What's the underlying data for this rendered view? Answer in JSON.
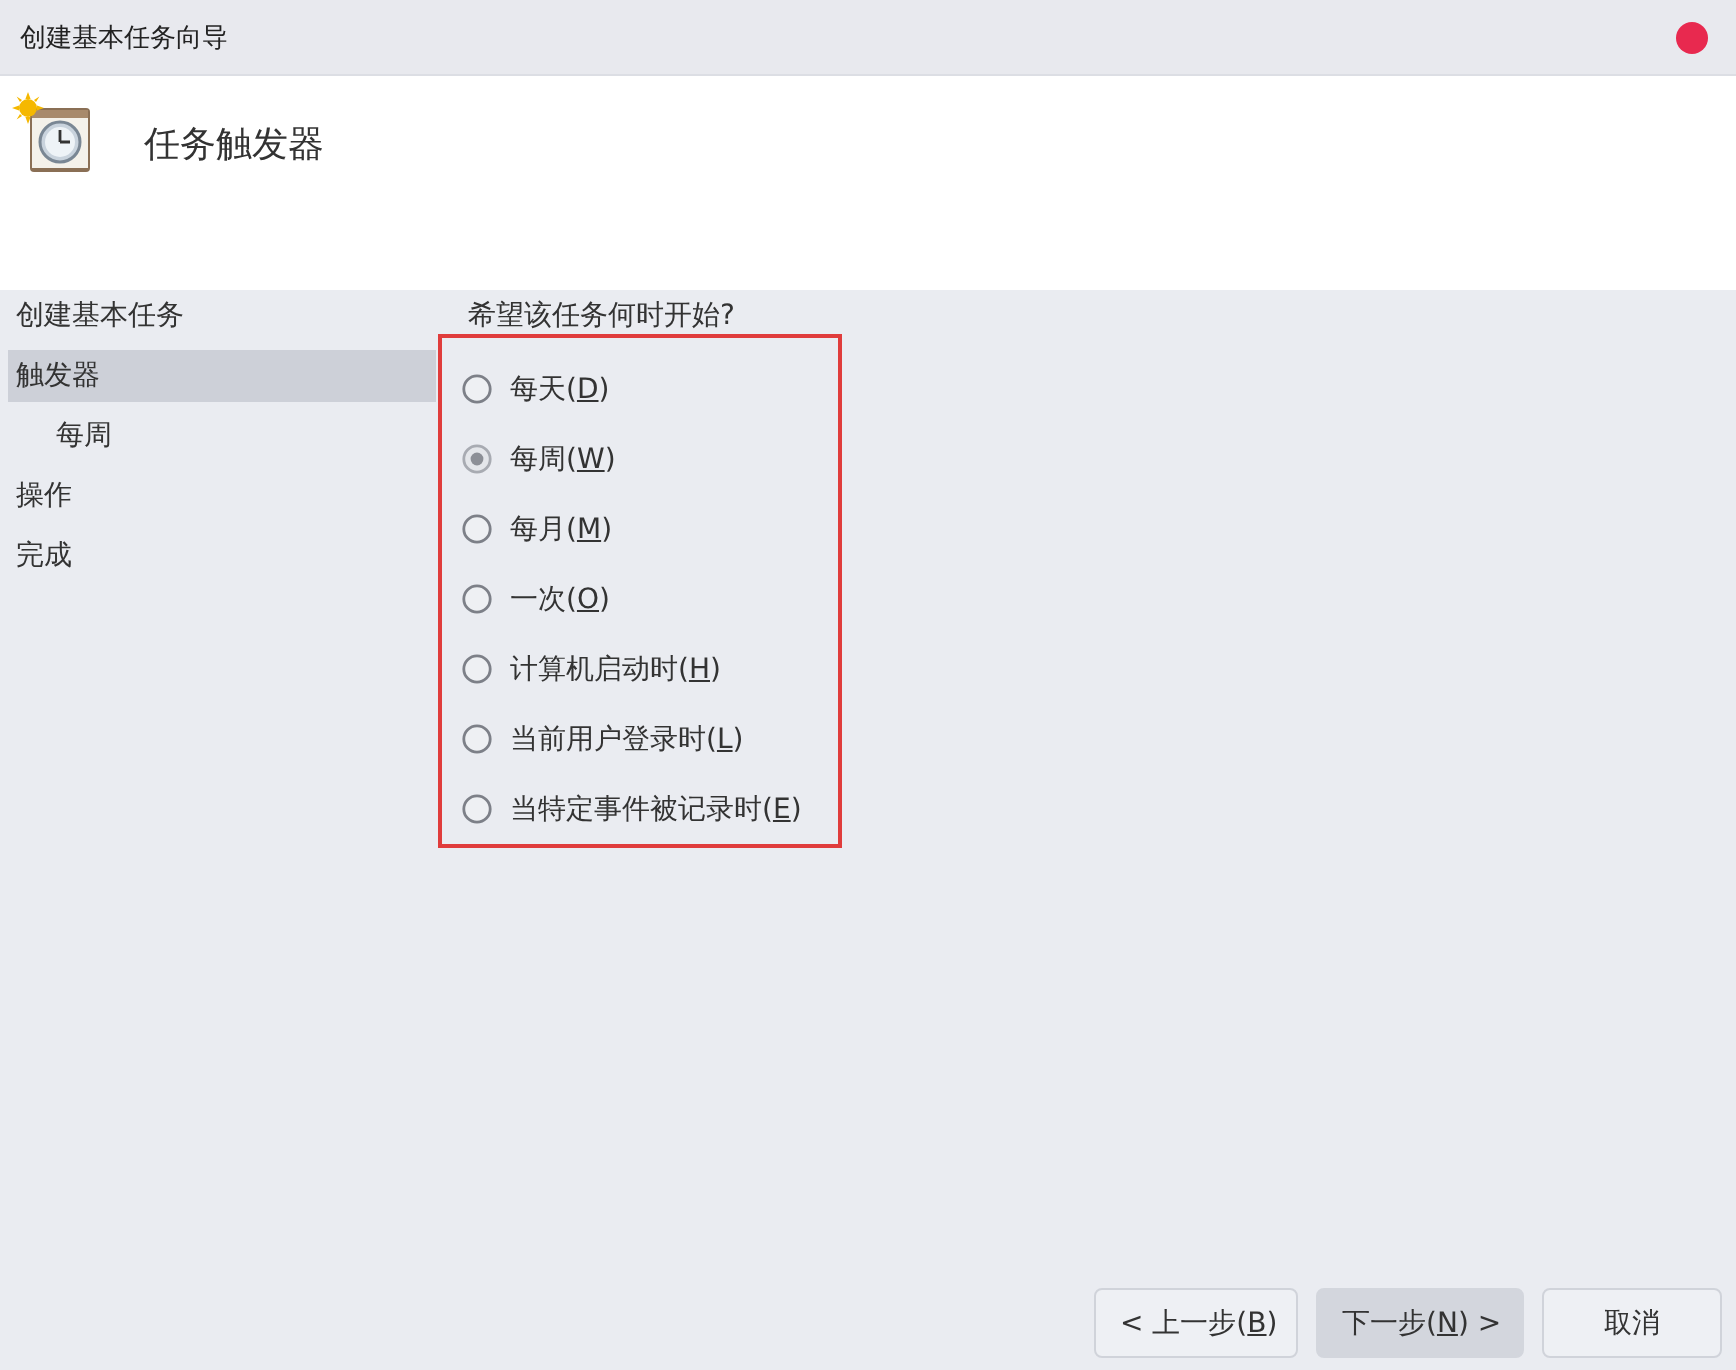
{
  "window": {
    "title": "创建基本任务向导"
  },
  "header": {
    "title": "任务触发器"
  },
  "sidebar": {
    "items": [
      {
        "label": "创建基本任务",
        "selected": false
      },
      {
        "label": "触发器",
        "selected": true,
        "children": [
          {
            "label": "每周",
            "selected": false
          }
        ]
      },
      {
        "label": "操作",
        "selected": false
      },
      {
        "label": "完成",
        "selected": false
      }
    ]
  },
  "trigger": {
    "question": "希望该任务何时开始?",
    "highlighted": true,
    "options": [
      {
        "label": "每天(",
        "access_key": "D",
        "label_end": ")",
        "selected": false
      },
      {
        "label": "每周(",
        "access_key": "W",
        "label_end": ")",
        "selected": true
      },
      {
        "label": "每月(",
        "access_key": "M",
        "label_end": ")",
        "selected": false
      },
      {
        "label": "一次(",
        "access_key": "O",
        "label_end": ")",
        "selected": false
      },
      {
        "label": "计算机启动时(",
        "access_key": "H",
        "label_end": ")",
        "selected": false
      },
      {
        "label": "当前用户登录时(",
        "access_key": "L",
        "label_end": ")",
        "selected": false
      },
      {
        "label": "当特定事件被记录时(",
        "access_key": "E",
        "label_end": ")",
        "selected": false
      }
    ]
  },
  "buttons": [
    {
      "label": "< 上一步(",
      "access_key": "B",
      "label_end": ")",
      "highlighted": false
    },
    {
      "label": "下一步(",
      "access_key": "N",
      "label_end": ") >",
      "highlighted": true
    },
    {
      "label": "取消",
      "highlighted": false
    }
  ]
}
